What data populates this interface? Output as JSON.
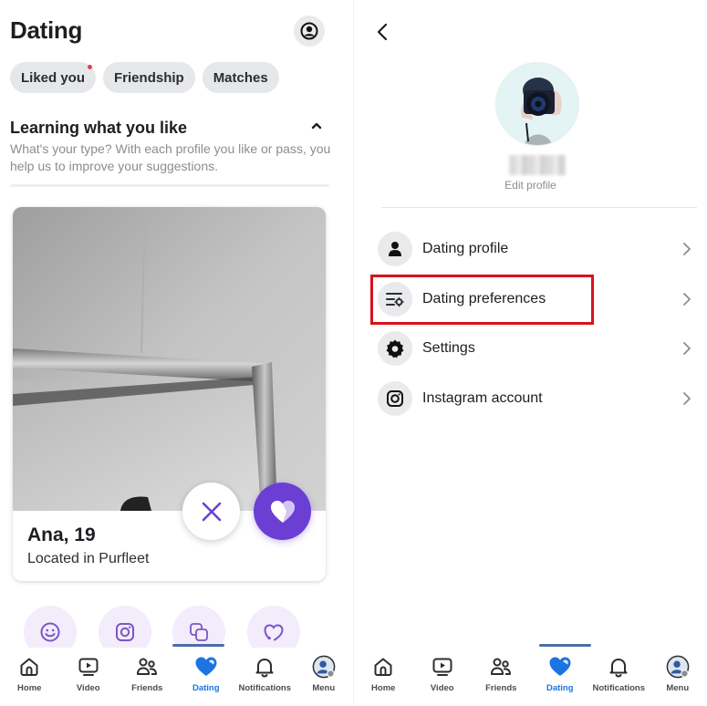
{
  "left_screen": {
    "title": "Dating",
    "profile_icon": "user-circle-icon",
    "chips": [
      {
        "label": "Liked you",
        "has_notification_dot": true
      },
      {
        "label": "Friendship",
        "has_notification_dot": false
      },
      {
        "label": "Matches",
        "has_notification_dot": false
      }
    ],
    "learning": {
      "title": "Learning what you like",
      "description": "What's your type? With each profile you like or pass, you help us to improve your suggestions.",
      "collapse_icon": "chevron-up-icon"
    },
    "profile_card": {
      "name_age": "Ana, 19",
      "location": "Located in Purfleet"
    },
    "actions": {
      "pass_icon": "close-icon",
      "like_icon": "heart-icon",
      "accent_color": "#6b3fd4"
    },
    "quick_actions": [
      {
        "icon": "smiley-icon"
      },
      {
        "icon": "instagram-icon"
      },
      {
        "icon": "overlap-squares-icon"
      },
      {
        "icon": "heart-outline-icon"
      }
    ]
  },
  "right_screen": {
    "back_icon": "chevron-left-icon",
    "edit_profile_label": "Edit profile",
    "menu_items": [
      {
        "label": "Dating profile",
        "icon": "person-icon"
      },
      {
        "label": "Dating preferences",
        "icon": "preferences-icon",
        "highlighted": true
      },
      {
        "label": "Settings",
        "icon": "gear-icon"
      },
      {
        "label": "Instagram account",
        "icon": "instagram-icon"
      }
    ],
    "highlight_color": "#d9121f"
  },
  "bottom_nav": {
    "items": [
      {
        "label": "Home",
        "icon": "home-icon"
      },
      {
        "label": "Video",
        "icon": "video-icon"
      },
      {
        "label": "Friends",
        "icon": "friends-icon"
      },
      {
        "label": "Dating",
        "icon": "dating-heart-icon",
        "active": true
      },
      {
        "label": "Notifications",
        "icon": "bell-icon"
      },
      {
        "label": "Menu",
        "icon": "avatar-icon"
      }
    ],
    "active_color": "#1b74e4"
  }
}
